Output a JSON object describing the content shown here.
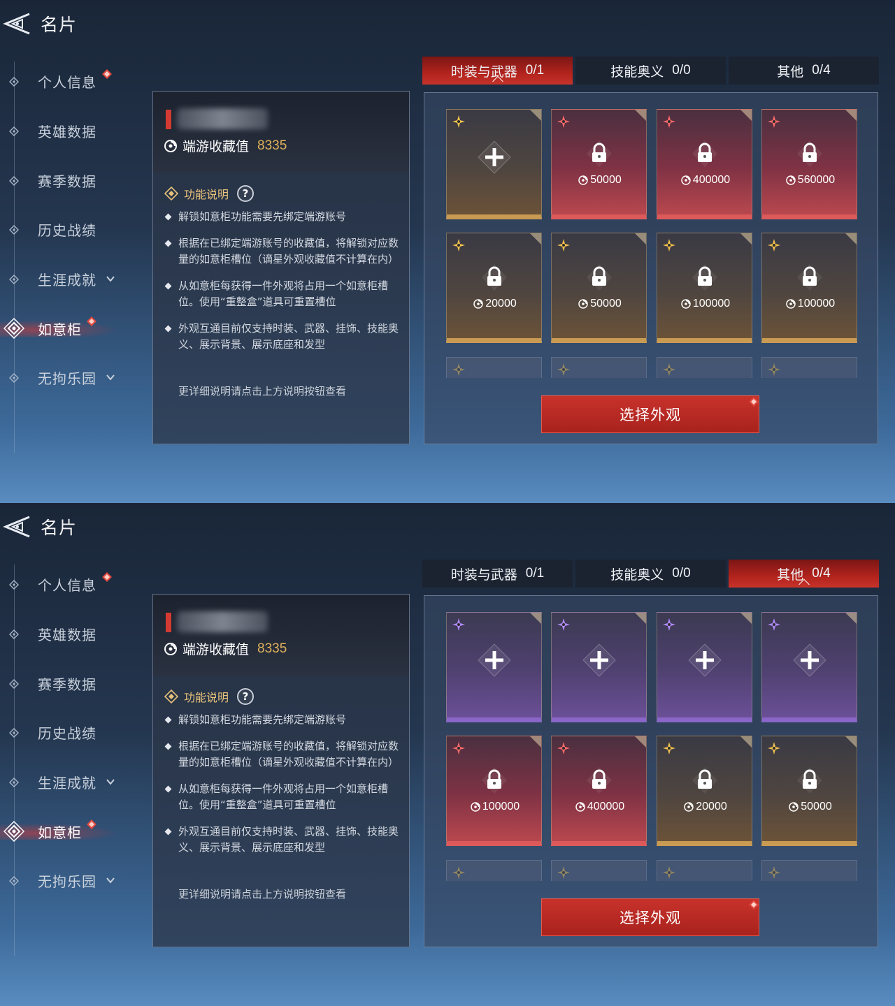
{
  "colors": {
    "accent_red": "#c8322b",
    "gold": "#e0b25a",
    "slot_gold": "#c99a52",
    "slot_red": "#dd5a5a",
    "slot_purple": "#8a66c8"
  },
  "header": {
    "title": "名片",
    "back_icon": "back-arrow-icon"
  },
  "sidebar": {
    "items": [
      {
        "label": "个人信息",
        "badge": true,
        "chevron": false
      },
      {
        "label": "英雄数据",
        "badge": false,
        "chevron": false
      },
      {
        "label": "赛季数据",
        "badge": false,
        "chevron": false
      },
      {
        "label": "历史战绩",
        "badge": false,
        "chevron": false
      },
      {
        "label": "生涯成就",
        "badge": false,
        "chevron": true
      },
      {
        "label": "如意柜",
        "badge": true,
        "chevron": false,
        "active": true
      },
      {
        "label": "无拘乐园",
        "badge": false,
        "chevron": true
      }
    ]
  },
  "info": {
    "collection_label": "端游收藏值",
    "collection_value": "8335",
    "func_title": "功能说明",
    "help_symbol": "?",
    "bullets": [
      "解锁如意柜功能需要先绑定端游账号",
      "根据在已绑定端游账号的收藏值，将解锁对应数量的如意柜槽位（谪星外观收藏值不计算在内）",
      "从如意柜每获得一件外观将占用一个如意柜槽位。使用“重整盒”道具可重置槽位",
      "外观互通目前仅支持时装、武器、挂饰、技能奥义、展示背景、展示底座和发型"
    ],
    "more_note": "更详细说明请点击上方说明按钮查看"
  },
  "tabs": [
    {
      "label": "时装与武器",
      "count": "0/1"
    },
    {
      "label": "技能奥义",
      "count": "0/0"
    },
    {
      "label": "其他",
      "count": "0/4"
    }
  ],
  "select_button": "选择外观",
  "panels": [
    {
      "active_tab": 0,
      "rows": [
        [
          {
            "color": "gold",
            "state": "add"
          },
          {
            "color": "red",
            "state": "locked",
            "price": "50000"
          },
          {
            "color": "red",
            "state": "locked",
            "price": "400000"
          },
          {
            "color": "red",
            "state": "locked",
            "price": "560000"
          }
        ],
        [
          {
            "color": "gold",
            "state": "locked",
            "price": "20000"
          },
          {
            "color": "gold",
            "state": "locked",
            "price": "50000"
          },
          {
            "color": "gold",
            "state": "locked",
            "price": "100000"
          },
          {
            "color": "gold",
            "state": "locked",
            "price": "100000"
          }
        ]
      ]
    },
    {
      "active_tab": 2,
      "rows": [
        [
          {
            "color": "purple",
            "state": "add"
          },
          {
            "color": "purple",
            "state": "add"
          },
          {
            "color": "purple",
            "state": "add"
          },
          {
            "color": "purple",
            "state": "add"
          }
        ],
        [
          {
            "color": "red",
            "state": "locked",
            "price": "100000"
          },
          {
            "color": "red",
            "state": "locked",
            "price": "400000"
          },
          {
            "color": "gold",
            "state": "locked",
            "price": "20000"
          },
          {
            "color": "gold",
            "state": "locked",
            "price": "50000"
          }
        ]
      ]
    }
  ]
}
